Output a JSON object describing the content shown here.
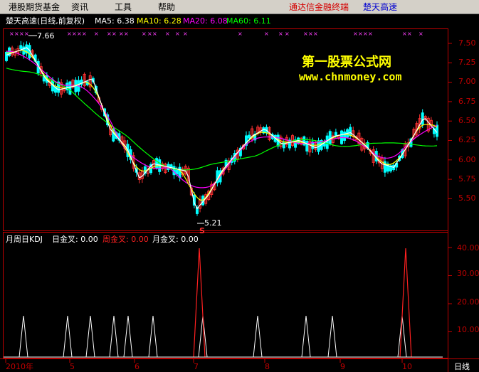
{
  "menu": {
    "items": [
      "港股期货基金",
      "资讯(I)",
      "工具(T)",
      "帮助(H)"
    ],
    "items_display": [
      "港股期货基金",
      "资讯",
      "工具",
      "帮助"
    ],
    "right_title_red": "通达信金融终端",
    "right_title_blue": "楚天高速"
  },
  "price_panel": {
    "title": "楚天高速(日线,前复权)",
    "ma": [
      {
        "label": "MA5: 6.38",
        "color": "#ffffff"
      },
      {
        "label": "MA10: 6.28",
        "color": "#ffff00"
      },
      {
        "label": "MA20: 6.08",
        "color": "#ff00ff"
      },
      {
        "label": "MA60: 6.11",
        "color": "#00ff00"
      }
    ],
    "high_label": "7.66",
    "low_label": "5.21",
    "sell_marker": "S",
    "yticks": [
      "7.50",
      "7.25",
      "7.00",
      "6.75",
      "6.50",
      "6.25",
      "6.00",
      "5.75",
      "5.50"
    ]
  },
  "watermark": {
    "line1": "第一股票公式网",
    "line2": "www.chnmoney.com"
  },
  "kdj_panel": {
    "title": "月周日KDJ",
    "labels": [
      {
        "text": "日金叉: 0.00",
        "color": "#ffffff"
      },
      {
        "text": "周金叉: 0.00",
        "color": "#ff2020"
      },
      {
        "text": "月金叉: 0.00",
        "color": "#ffffff"
      }
    ],
    "yticks": [
      "40.00",
      "30.00",
      "20.00",
      "10.00"
    ]
  },
  "time_axis": {
    "labels": [
      "2010年",
      "5",
      "6",
      "7",
      "8",
      "9",
      "10"
    ],
    "period": "日线"
  },
  "colors": {
    "up": "#ff3232",
    "down": "#00ffff",
    "frame": "#c00000",
    "ma5": "#ffffff",
    "ma10": "#ffff00",
    "ma20": "#ff00ff",
    "ma60": "#00ff00"
  }
}
